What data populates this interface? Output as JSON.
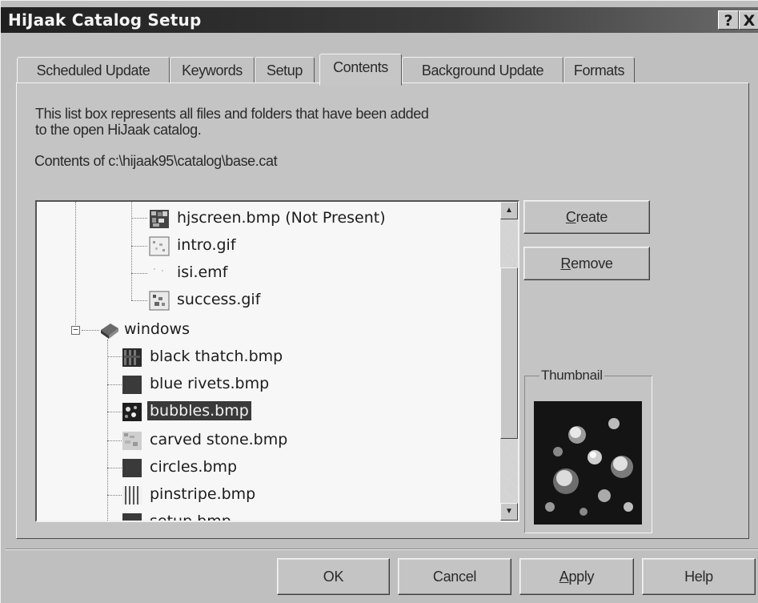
{
  "window": {
    "title": "HiJaak Catalog Setup",
    "help_glyph": "?",
    "close_glyph": "X"
  },
  "tabs": [
    {
      "label": "Scheduled Update",
      "active": false
    },
    {
      "label": "Keywords",
      "active": false
    },
    {
      "label": "Setup",
      "active": false
    },
    {
      "label": "Contents",
      "active": true
    },
    {
      "label": "Background Update",
      "active": false
    },
    {
      "label": "Formats",
      "active": false
    }
  ],
  "contents": {
    "description_line1": "This list box represents all files and folders that have been added",
    "description_line2": "to the open HiJaak catalog.",
    "path_label": "Contents of c:\\hijaak95\\catalog\\base.cat"
  },
  "tree": {
    "items": [
      {
        "label": "hjscreen.bmp (Not Present)",
        "icon": "image-file-icon",
        "level": 2
      },
      {
        "label": "intro.gif",
        "icon": "image-file-icon",
        "level": 2
      },
      {
        "label": "isi.emf",
        "icon": "blank-file-icon",
        "level": 2
      },
      {
        "label": "success.gif",
        "icon": "image-file-icon",
        "level": 2
      },
      {
        "label": "windows",
        "icon": "folder-book-icon",
        "level": 1,
        "expanded": true
      },
      {
        "label": "black thatch.bmp",
        "icon": "image-file-icon",
        "level": 2
      },
      {
        "label": "blue rivets.bmp",
        "icon": "image-file-icon",
        "level": 2
      },
      {
        "label": "bubbles.bmp",
        "icon": "image-file-icon",
        "level": 2,
        "selected": true
      },
      {
        "label": "carved stone.bmp",
        "icon": "image-file-icon",
        "level": 2
      },
      {
        "label": "circles.bmp",
        "icon": "image-file-icon",
        "level": 2
      },
      {
        "label": "pinstripe.bmp",
        "icon": "image-file-icon",
        "level": 2
      },
      {
        "label": "setup.bmp",
        "icon": "image-file-icon",
        "level": 2
      }
    ],
    "collapse_glyph": "−",
    "scroll_up_glyph": "▲",
    "scroll_down_glyph": "▼"
  },
  "side_buttons": {
    "create_mnemonic": "C",
    "create_rest": "reate",
    "remove_mnemonic": "R",
    "remove_rest": "emove"
  },
  "thumbnail": {
    "label": "Thumbnail"
  },
  "footer": {
    "ok": "OK",
    "cancel": "Cancel",
    "apply_mnemonic": "A",
    "apply_rest": "pply",
    "help": "Help"
  }
}
